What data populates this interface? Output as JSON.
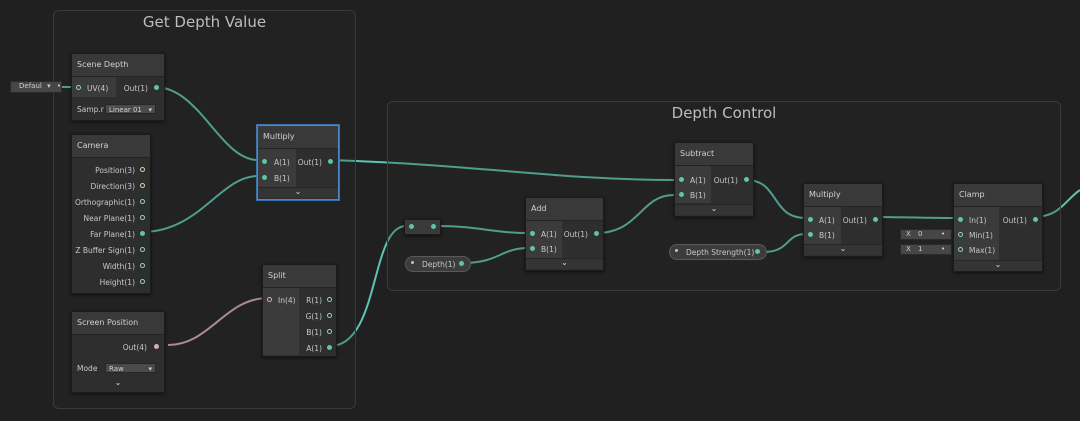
{
  "groups": {
    "get_depth": {
      "title": "Get Depth Value"
    },
    "depth_control": {
      "title": "Depth Control"
    }
  },
  "scene_depth": {
    "title": "Scene Depth",
    "default_label": "Defaul",
    "input_uv": "UV(4)",
    "output": "Out(1)",
    "sampler_label": "Samp.r",
    "sampler_value": "Linear 01"
  },
  "camera": {
    "title": "Camera",
    "outputs": [
      "Position(3)",
      "Direction(3)",
      "Orthographic(1)",
      "Near Plane(1)",
      "Far Plane(1)",
      "Z Buffer Sign(1)",
      "Width(1)",
      "Height(1)"
    ]
  },
  "screen_position": {
    "title": "Screen Position",
    "output": "Out(4)",
    "mode_label": "Mode",
    "mode_value": "Raw"
  },
  "multiply1": {
    "title": "Multiply",
    "in_a": "A(1)",
    "in_b": "B(1)",
    "out": "Out(1)"
  },
  "split": {
    "title": "Split",
    "in": "In(4)",
    "out_r": "R(1)",
    "out_g": "G(1)",
    "out_b": "B(1)",
    "out_a": "A(1)"
  },
  "add": {
    "title": "Add",
    "in_a": "A(1)",
    "in_b": "B(1)",
    "out": "Out(1)"
  },
  "subtract": {
    "title": "Subtract",
    "in_a": "A(1)",
    "in_b": "B(1)",
    "out": "Out(1)"
  },
  "multiply2": {
    "title": "Multiply",
    "in_a": "A(1)",
    "in_b": "B(1)",
    "out": "Out(1)"
  },
  "clamp": {
    "title": "Clamp",
    "in": "In(1)",
    "min": "Min(1)",
    "max": "Max(1)",
    "out": "Out(1)",
    "x_label": "X",
    "min_value": "0",
    "max_value": "1"
  },
  "properties": {
    "depth": "Depth(1)",
    "depth_strength": "Depth Strength(1)"
  },
  "colors": {
    "wire_float": "#5ec4b0",
    "wire_vector4": "#d7a9c2",
    "selected": "#4a88c7"
  },
  "icons": {
    "chevron": "chevron-down-icon"
  }
}
